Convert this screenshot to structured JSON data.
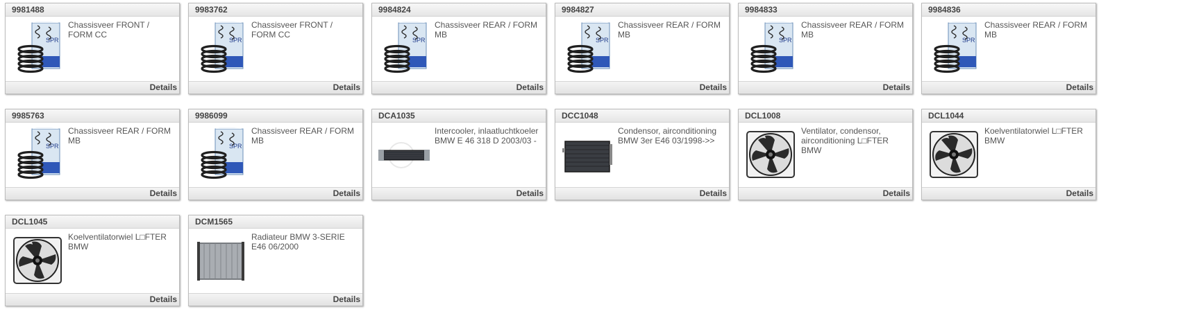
{
  "products": [
    {
      "code": "9981488",
      "desc": "Chassisveer FRONT / FORM CC",
      "image": "coil-spring-box",
      "details": "Details"
    },
    {
      "code": "9983762",
      "desc": "Chassisveer FRONT / FORM CC",
      "image": "coil-spring-box",
      "details": "Details"
    },
    {
      "code": "9984824",
      "desc": "Chassisveer REAR / FORM MB",
      "image": "coil-spring-box",
      "details": "Details"
    },
    {
      "code": "9984827",
      "desc": "Chassisveer REAR / FORM MB",
      "image": "coil-spring-box",
      "details": "Details"
    },
    {
      "code": "9984833",
      "desc": "Chassisveer REAR / FORM MB",
      "image": "coil-spring-box",
      "details": "Details"
    },
    {
      "code": "9984836",
      "desc": "Chassisveer REAR / FORM MB",
      "image": "coil-spring-box",
      "details": "Details"
    },
    {
      "code": "9985763",
      "desc": "Chassisveer REAR / FORM MB",
      "image": "coil-spring-box",
      "details": "Details"
    },
    {
      "code": "9986099",
      "desc": "Chassisveer REAR / FORM MB",
      "image": "coil-spring-box",
      "details": "Details"
    },
    {
      "code": "DCA1035",
      "desc": "Intercooler, inlaatluchtkoeler BMW E 46 318 D 2003/03 -",
      "image": "intercooler",
      "details": "Details"
    },
    {
      "code": "DCC1048",
      "desc": "Condensor, airconditioning BMW 3er E46 03/1998->>",
      "image": "condenser",
      "details": "Details"
    },
    {
      "code": "DCL1008",
      "desc": "Ventilator, condensor, airconditioning L□FTER BMW",
      "image": "fan",
      "details": "Details"
    },
    {
      "code": "DCL1044",
      "desc": "Koelventilatorwiel L□FTER BMW",
      "image": "fan",
      "details": "Details"
    },
    {
      "code": "DCL1045",
      "desc": "Koelventilatorwiel L□FTER BMW",
      "image": "fan",
      "details": "Details"
    },
    {
      "code": "DCM1565",
      "desc": "Radiateur BMW 3-SERIE E46 06/2000",
      "image": "radiator",
      "details": "Details"
    }
  ]
}
